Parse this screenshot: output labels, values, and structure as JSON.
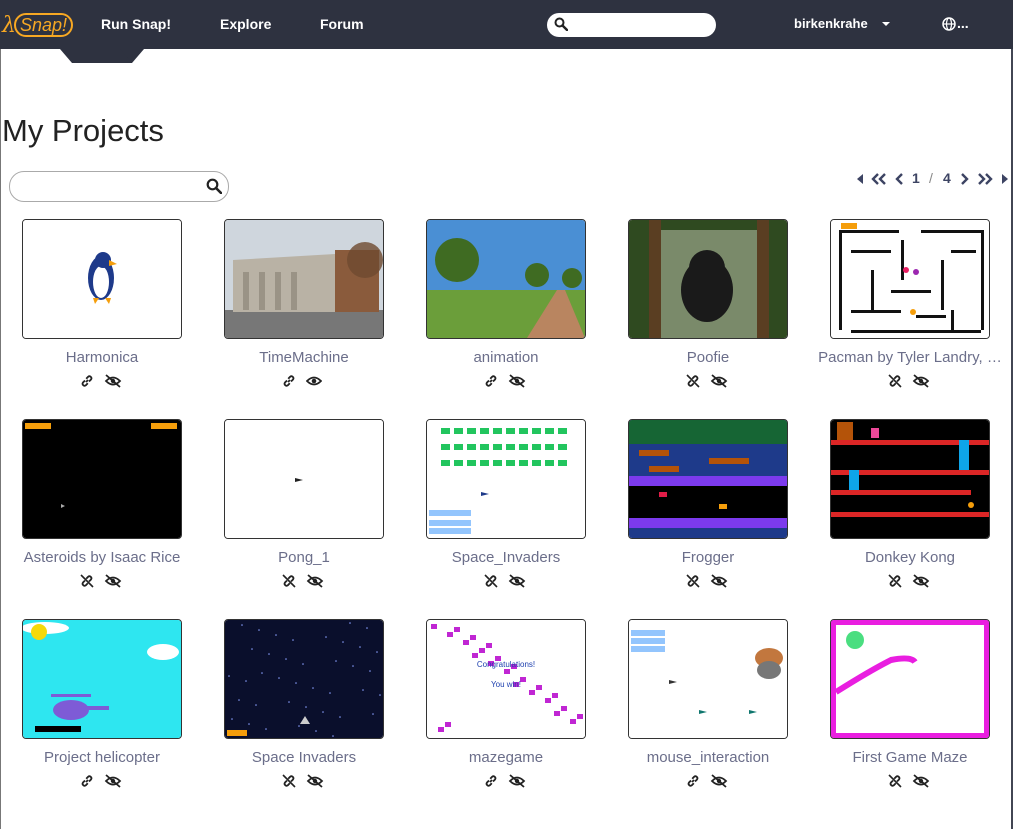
{
  "nav": {
    "logo_text": "Snap!",
    "links": [
      "Run Snap!",
      "Explore",
      "Forum"
    ],
    "search_placeholder": "",
    "user": "birkenkrahe",
    "lang": "..."
  },
  "page": {
    "title": "My Projects",
    "search_placeholder": ""
  },
  "pagination": {
    "current": "1",
    "separator": "/",
    "total": "4"
  },
  "projects": [
    {
      "name": "Harmonica",
      "shared": true,
      "published": false,
      "thumb": "penguin"
    },
    {
      "name": "TimeMachine",
      "shared": true,
      "published": true,
      "thumb": "building"
    },
    {
      "name": "animation",
      "shared": true,
      "published": false,
      "thumb": "park"
    },
    {
      "name": "Poofie",
      "shared": false,
      "published": false,
      "thumb": "puppy"
    },
    {
      "name": "Pacman by Tyler Landry, …",
      "shared": false,
      "published": false,
      "thumb": "maze"
    },
    {
      "name": "Asteroids by Isaac Rice",
      "shared": false,
      "published": false,
      "thumb": "asteroids"
    },
    {
      "name": "Pong_1",
      "shared": false,
      "published": false,
      "thumb": "pong"
    },
    {
      "name": "Space_Invaders",
      "shared": false,
      "published": false,
      "thumb": "invaders"
    },
    {
      "name": "Frogger",
      "shared": false,
      "published": false,
      "thumb": "frogger"
    },
    {
      "name": "Donkey Kong",
      "shared": false,
      "published": false,
      "thumb": "donkeykong"
    },
    {
      "name": "Project helicopter",
      "shared": true,
      "published": false,
      "thumb": "helicopter"
    },
    {
      "name": "Space Invaders",
      "shared": false,
      "published": false,
      "thumb": "space"
    },
    {
      "name": "mazegame",
      "shared": true,
      "published": false,
      "thumb": "mazegame"
    },
    {
      "name": "mouse_interaction",
      "shared": true,
      "published": false,
      "thumb": "mouse"
    },
    {
      "name": "First Game Maze",
      "shared": false,
      "published": false,
      "thumb": "firstmaze"
    }
  ],
  "thumb_texts": {
    "mazegame_line1": "Congratulations!",
    "mazegame_line2": "You win!"
  },
  "colors": {
    "navbar": "#2e3240",
    "logo": "#f7a823",
    "project_name": "#6b6e8a",
    "pager": "#3d4463"
  }
}
